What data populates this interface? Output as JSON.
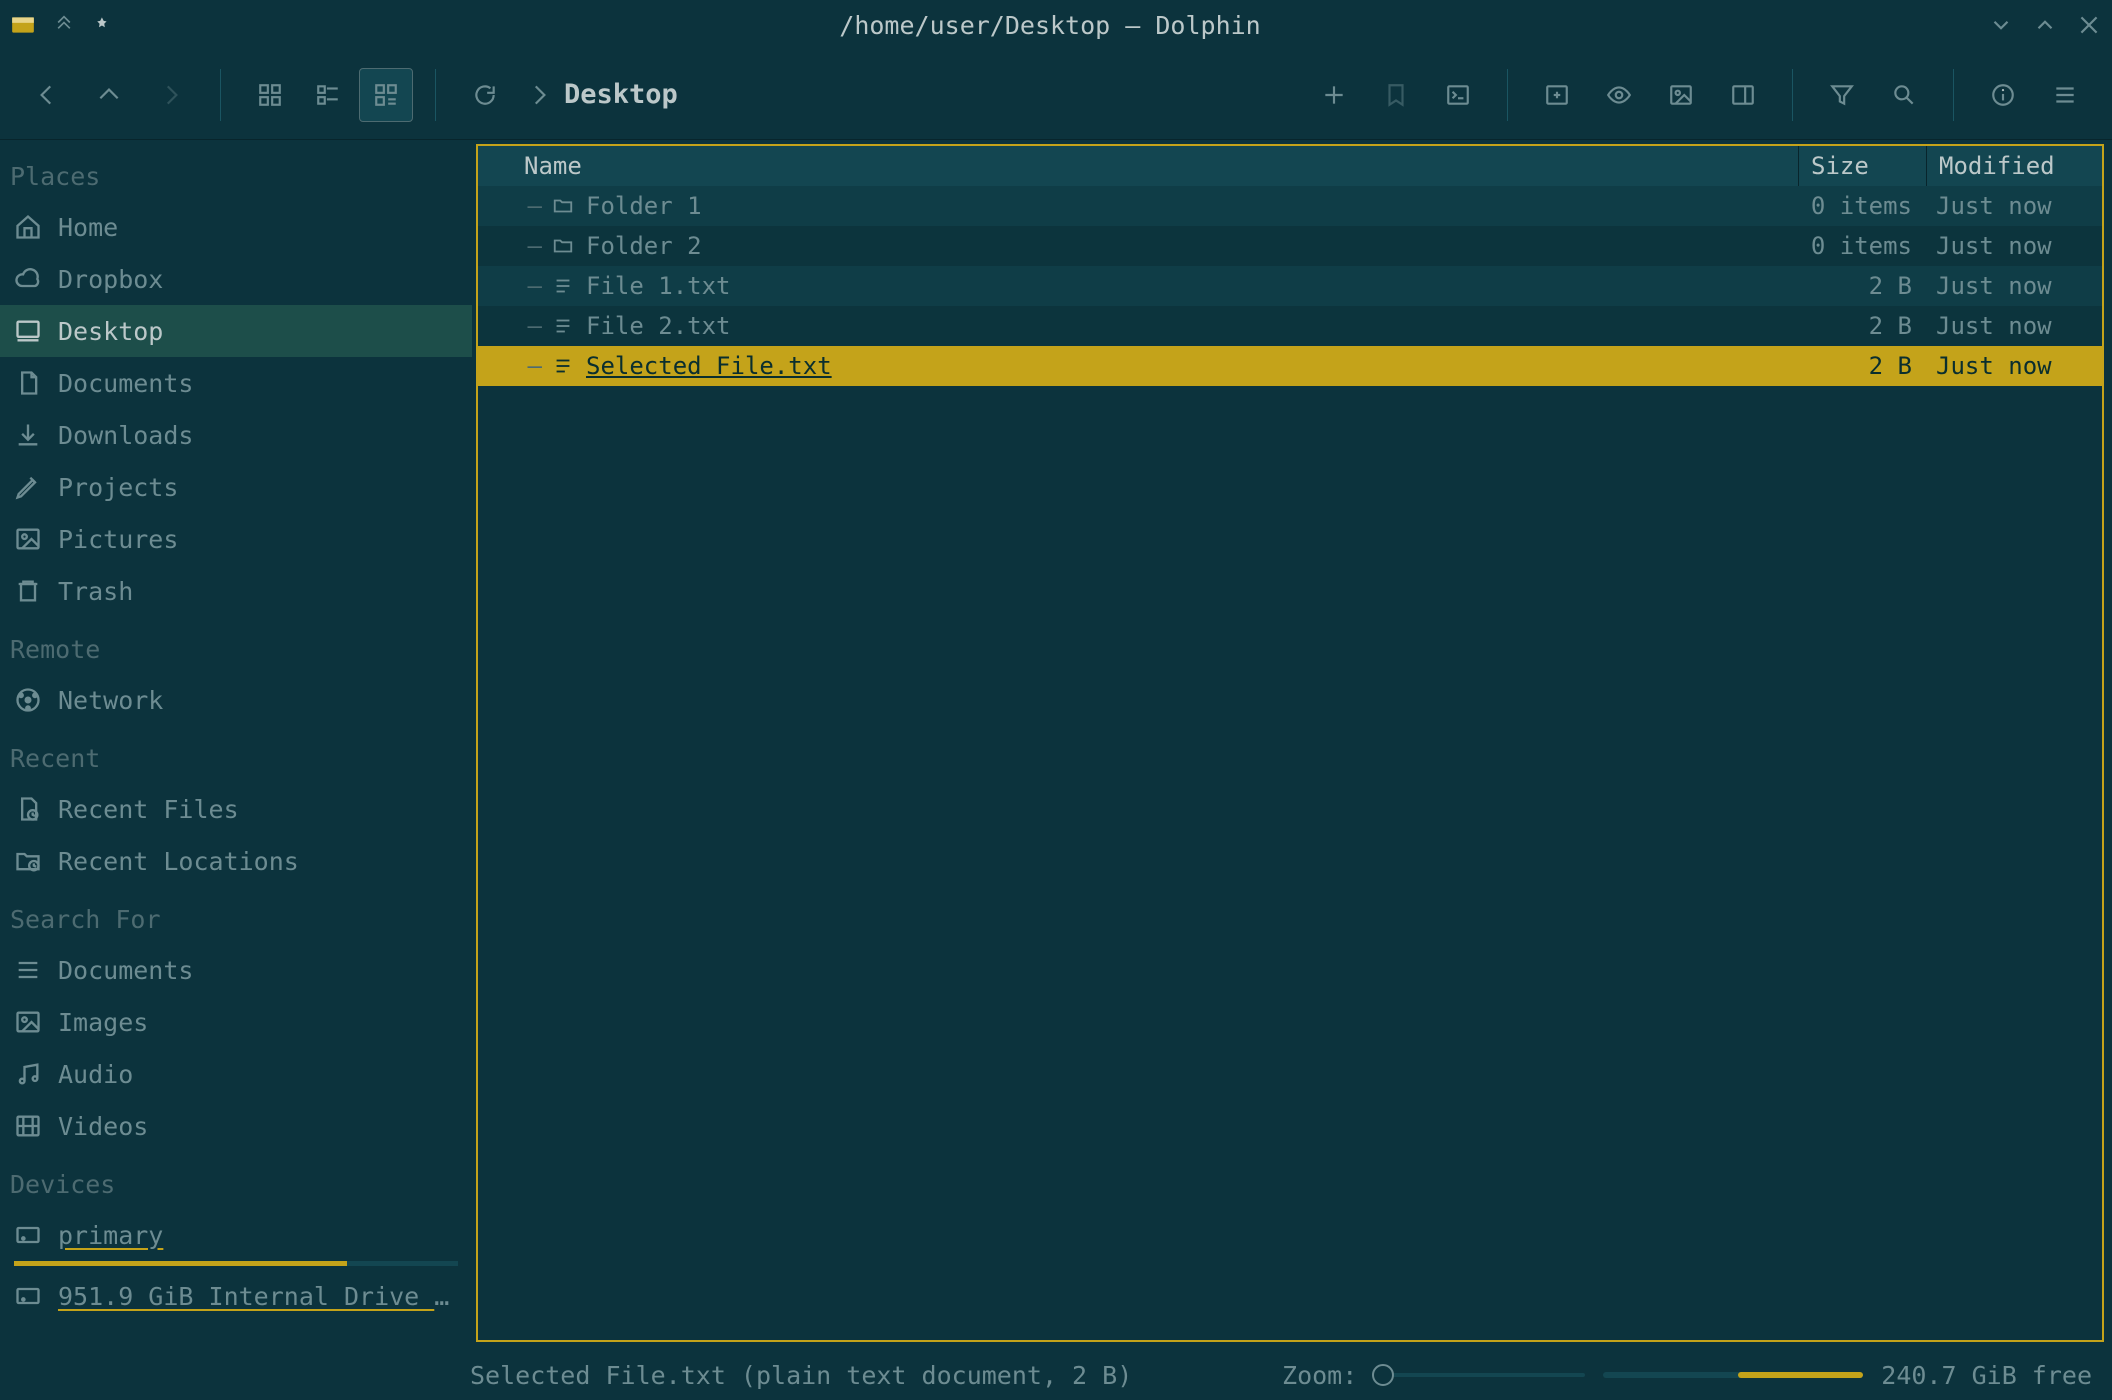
{
  "window": {
    "title": "/home/user/Desktop — Dolphin"
  },
  "toolbar": {
    "path_segment": "Desktop"
  },
  "sidebar": {
    "sections": [
      {
        "heading": "Places",
        "items": [
          {
            "icon": "home",
            "label": "Home"
          },
          {
            "icon": "cloud",
            "label": "Dropbox"
          },
          {
            "icon": "desktop",
            "label": "Desktop",
            "active": true
          },
          {
            "icon": "doc",
            "label": "Documents"
          },
          {
            "icon": "download",
            "label": "Downloads"
          },
          {
            "icon": "pencil",
            "label": "Projects"
          },
          {
            "icon": "image",
            "label": "Pictures"
          },
          {
            "icon": "trash",
            "label": "Trash"
          }
        ]
      },
      {
        "heading": "Remote",
        "items": [
          {
            "icon": "network",
            "label": "Network"
          }
        ]
      },
      {
        "heading": "Recent",
        "items": [
          {
            "icon": "recent-files",
            "label": "Recent Files"
          },
          {
            "icon": "recent-loc",
            "label": "Recent Locations"
          }
        ]
      },
      {
        "heading": "Search For",
        "items": [
          {
            "icon": "lines",
            "label": "Documents"
          },
          {
            "icon": "image",
            "label": "Images"
          },
          {
            "icon": "audio",
            "label": "Audio"
          },
          {
            "icon": "video",
            "label": "Videos"
          }
        ]
      },
      {
        "heading": "Devices",
        "items": [
          {
            "icon": "drive",
            "label": "primary",
            "underlined": true,
            "usage_pct": 75
          },
          {
            "icon": "drive",
            "label": "951.9 GiB Internal Drive (…",
            "underlined": true
          }
        ]
      }
    ]
  },
  "filelist": {
    "columns": {
      "name": "Name",
      "size": "Size",
      "modified": "Modified"
    },
    "rows": [
      {
        "type": "folder",
        "name": "Folder 1",
        "size": "0 items",
        "modified": "Just now"
      },
      {
        "type": "folder",
        "name": "Folder 2",
        "size": "0 items",
        "modified": "Just now"
      },
      {
        "type": "file",
        "name": "File 1.txt",
        "size": "2 B",
        "modified": "Just now"
      },
      {
        "type": "file",
        "name": "File 2.txt",
        "size": "2 B",
        "modified": "Just now"
      },
      {
        "type": "file",
        "name": "Selected File.txt",
        "size": "2 B",
        "modified": "Just now",
        "selected": true
      }
    ]
  },
  "statusbar": {
    "text": "Selected File.txt (plain text document, 2 B)",
    "zoom_label": "Zoom:",
    "disk_free": "240.7 GiB free",
    "disk_fill_pct": 48
  }
}
